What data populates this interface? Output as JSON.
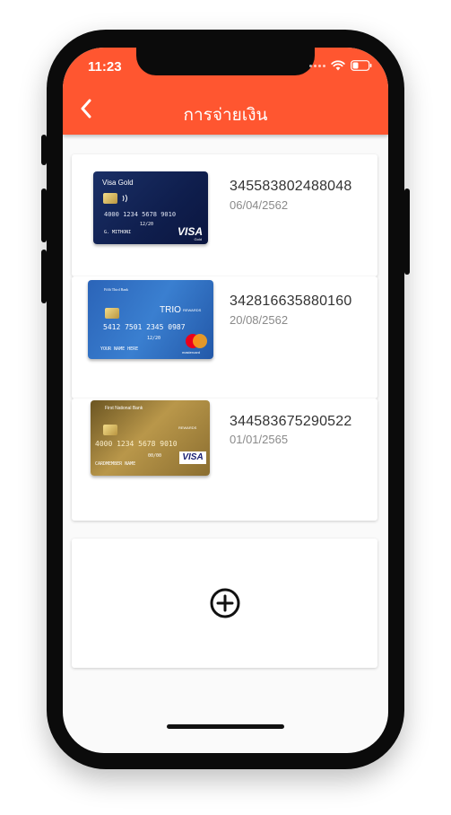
{
  "status_bar": {
    "time": "11:23"
  },
  "header": {
    "title": "การจ่ายเงิน"
  },
  "cards": [
    {
      "name": "Visa Gold",
      "number": "345583802488048",
      "date": "06/04/2562",
      "art": {
        "brand": "VISA",
        "brand_sub": "Gold",
        "embossed_number": "4000 1234 5678 9010",
        "expiry": "12/20",
        "holder": "G. MITHONI"
      }
    },
    {
      "name": "TRIO REWARDS",
      "number": "342816635880160",
      "date": "20/08/2562",
      "art": {
        "bank": "Fifth Third Bank",
        "brand": "TRIO",
        "brand_sub": "REWARDS",
        "embossed_number": "5412 7501 2345 0987",
        "expiry": "12/20",
        "holder": "YOUR NAME HERE",
        "network": "mastercard"
      }
    },
    {
      "name": "First National Bank",
      "number": "344583675290522",
      "date": "01/01/2565",
      "art": {
        "bank": "First National Bank",
        "brand": "REWARDS",
        "embossed_number": "4000 1234 5678 9010",
        "expiry": "00/00",
        "holder": "CARDMEMBER NAME",
        "network": "VISA"
      }
    }
  ],
  "icons": {
    "back": "chevron-left-icon",
    "add": "circle-plus-icon",
    "wifi": "wifi-icon",
    "battery": "battery-icon"
  },
  "colors": {
    "appbar": "#ff5630",
    "background": "#fafafa"
  }
}
